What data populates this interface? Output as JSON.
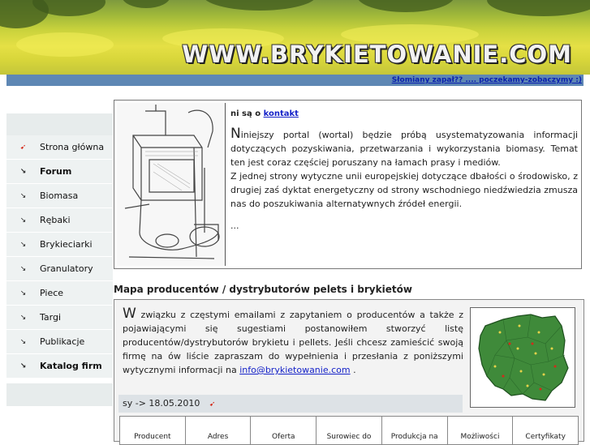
{
  "header": {
    "site_title": "WWW.BRYKIETOWANIE.COM",
    "slogan": "Słomiany zapał?? .... poczekamy-zobaczymy :)"
  },
  "sidebar": {
    "items": [
      {
        "label": "Strona główna",
        "icon": "red-arrow-icon"
      },
      {
        "label": "Forum",
        "icon": "down-arrow-icon"
      },
      {
        "label": "Biomasa",
        "icon": "down-arrow-icon"
      },
      {
        "label": "Rębaki",
        "icon": "down-arrow-icon"
      },
      {
        "label": "Brykieciarki",
        "icon": "down-arrow-icon"
      },
      {
        "label": "Granulatory",
        "icon": "down-arrow-icon"
      },
      {
        "label": "Piece",
        "icon": "down-arrow-icon"
      },
      {
        "label": "Targi",
        "icon": "down-arrow-icon"
      },
      {
        "label": "Publikacje",
        "icon": "down-arrow-icon"
      },
      {
        "label": "Katalog firm",
        "icon": "down-arrow-icon"
      }
    ]
  },
  "intro": {
    "head_prefix": "ni są o",
    "head_link": "kontakt",
    "first_letter": "N",
    "paragraph1_rest": "iniejszy portal (wortal) będzie próbą usystematyzowania informacji dotyczących pozyskiwania, przetwarzania i wykorzystania biomasy. Temat ten jest coraz częściej poruszany na łamach prasy i mediów.",
    "paragraph2": "Z jednej strony wytyczne unii europejskiej dotyczące dbałości o środowisko, z drugiej zaś dyktat energetyczny od strony wschodniego niedźwiedzia zmusza nas do poszukiwania alternatywnych źródeł energii.",
    "ellipsis": "..."
  },
  "map_section": {
    "title": "Mapa producentów / dystrybutorów pelets i brykietów",
    "first_letter": "W",
    "text": "związku z częstymi emailami z zapytaniem o producentów a także z pojawiającymi się sugestiami postanowiłem stworzyć listę producentów/dystrybutorów brykietu i pellets. Jeśli chcesz zamieścić swoją firmę na ów liście zapraszam do wypełnienia i przesłania z poniższymi wytycznymi informacji na",
    "email": "info@brykietowanie.com",
    "text_end": ".",
    "updated": "sy -> 18.05.2010",
    "table_headers": [
      "Producent",
      "Adres",
      "Oferta",
      "Surowiec do",
      "Produkcja na",
      "Możliwości",
      "Certyfikaty"
    ]
  },
  "colors": {
    "slogan_bar": "#5e87b4",
    "link": "#1522c8",
    "map_green": "#3f8a3a",
    "sidebar_bg": "#eef2f2"
  }
}
